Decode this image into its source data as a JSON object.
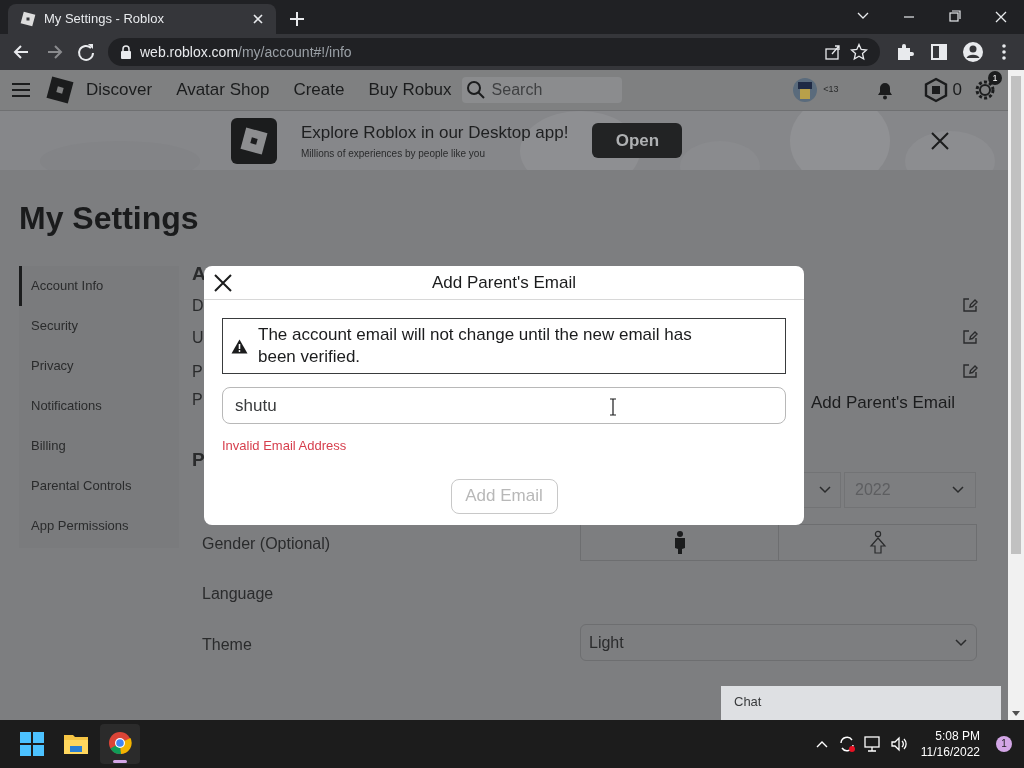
{
  "browser": {
    "tab_title": "My Settings - Roblox",
    "url_host": "web.roblox.com",
    "url_path": "/my/account#!/info"
  },
  "nav": {
    "items": [
      "Discover",
      "Avatar Shop",
      "Create",
      "Buy Robux"
    ],
    "search_placeholder": "Search",
    "age": "<13",
    "robux": "0",
    "settings_badge": "1"
  },
  "banner": {
    "title": "Explore Roblox in our Desktop app!",
    "subtitle": "Millions of experiences by people like you",
    "button": "Open"
  },
  "page_title": "My Settings",
  "sidebar": {
    "items": [
      {
        "label": "Account Info",
        "selected": true
      },
      {
        "label": "Security",
        "selected": false
      },
      {
        "label": "Privacy",
        "selected": false
      },
      {
        "label": "Notifications",
        "selected": false
      },
      {
        "label": "Billing",
        "selected": false
      },
      {
        "label": "Parental Controls",
        "selected": false
      },
      {
        "label": "App Permissions",
        "selected": false
      }
    ]
  },
  "content": {
    "section_heading": "A",
    "rows": [
      "D",
      "U",
      "P",
      "P"
    ],
    "add_parent_email": "Add Parent's Email",
    "section2_heading": "P",
    "birthday_year": "2022",
    "gender_label": "Gender (Optional)",
    "language_label": "Language",
    "theme_label": "Theme",
    "theme_value": "Light"
  },
  "chat": {
    "label": "Chat"
  },
  "modal": {
    "title": "Add Parent's Email",
    "warning": "The account email will not change until the new email has been verified.",
    "input_value": "shutu",
    "error": "Invalid Email Address",
    "button": "Add Email",
    "button_disabled": true
  },
  "taskbar": {
    "time": "5:08 PM",
    "date": "11/16/2022",
    "notification_count": "1"
  }
}
